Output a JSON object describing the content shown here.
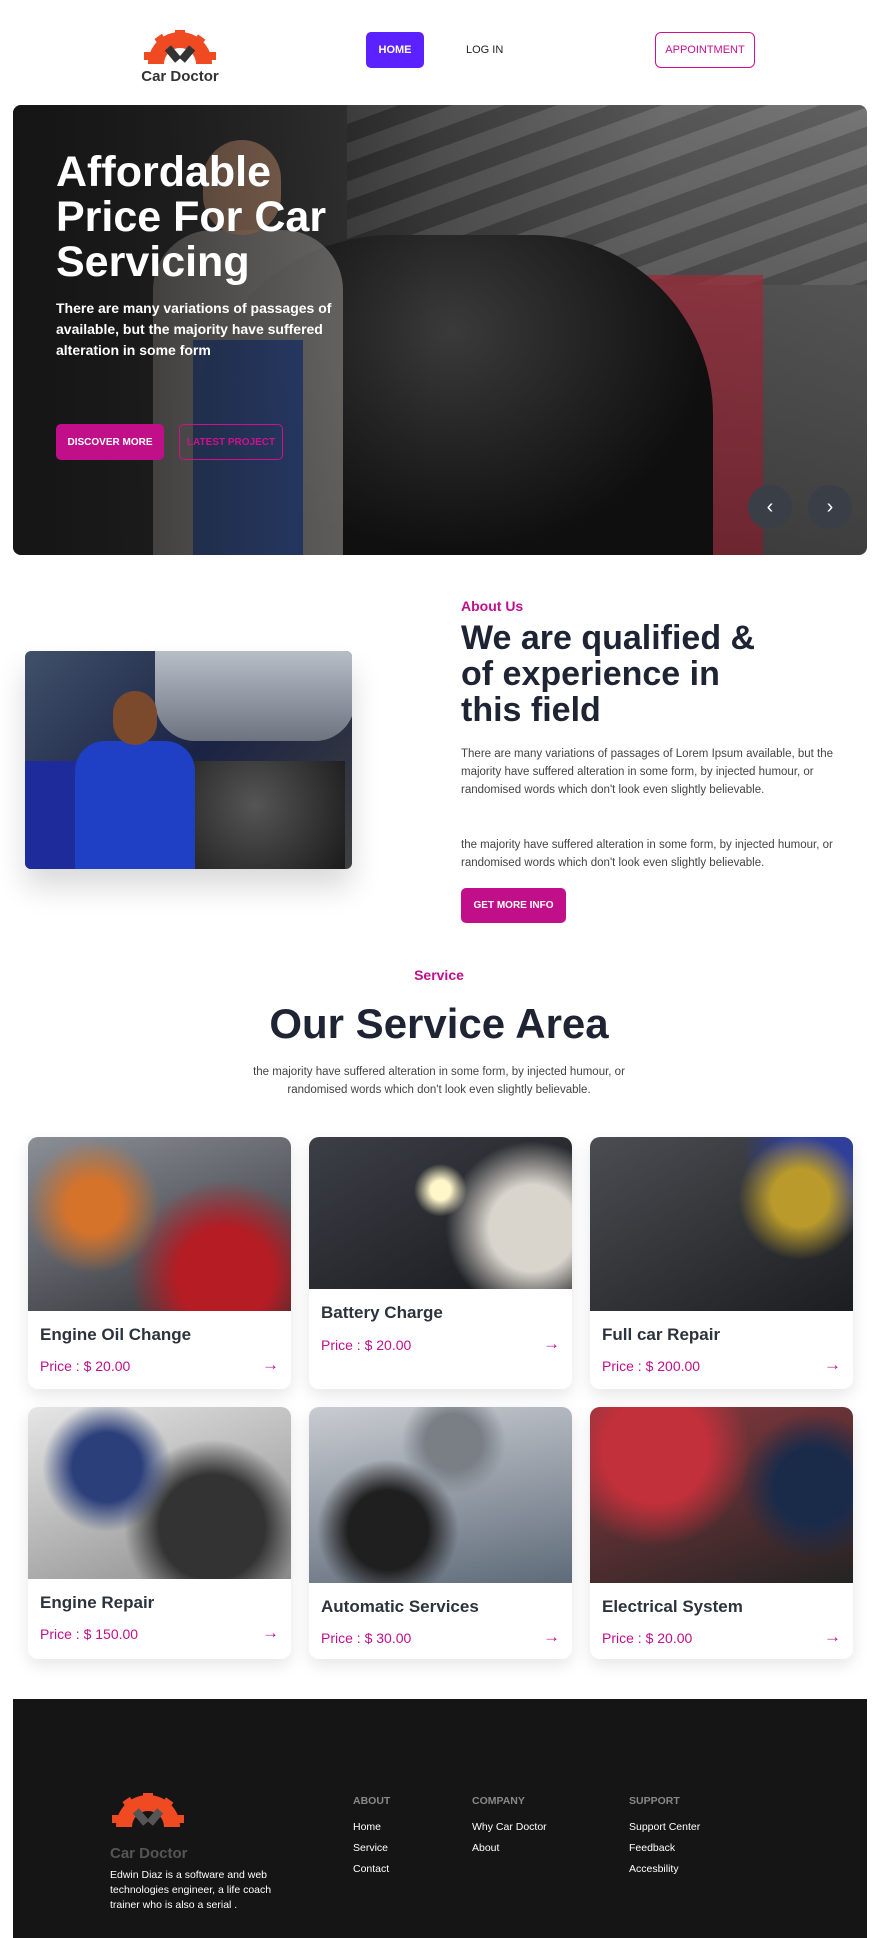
{
  "brand": {
    "name": "Car Doctor",
    "logo_icon": "gear-wrench-icon",
    "accent": "#c10f8a",
    "logo_color": "#f04a23"
  },
  "nav": {
    "home": "HOME",
    "login": "LOG IN",
    "appointment": "APPOINTMENT"
  },
  "hero": {
    "title": "Affordable Price For Car Servicing",
    "subtitle": "There are many variations of passages of available, but the majority have suffered alteration in some form",
    "discover": "DISCOVER MORE",
    "latest": "LATEST PROJECT",
    "prev": "‹",
    "next": "›"
  },
  "about": {
    "label": "About Us",
    "title": "We are qualified & of experience in this field",
    "p1": "There are many variations of passages of Lorem Ipsum available, but the majority have suffered alteration in some form, by injected humour, or randomised words which don't look even slightly believable.",
    "p2": "the majority have suffered alteration in some form, by injected humour, or randomised words which don't look even slightly believable.",
    "button": "GET MORE INFO"
  },
  "service": {
    "label": "Service",
    "title": "Our Service Area",
    "desc": "the majority have suffered alteration in some form, by injected humour, or randomised words which don't look even slightly believable.",
    "items": [
      {
        "name": "Engine Oil Change",
        "price": "Price : $ 20.00",
        "arrow": "→"
      },
      {
        "name": "Battery Charge",
        "price": "Price : $ 20.00",
        "arrow": "→"
      },
      {
        "name": "Full car Repair",
        "price": "Price : $ 200.00",
        "arrow": "→"
      },
      {
        "name": "Engine Repair",
        "price": "Price : $ 150.00",
        "arrow": "→"
      },
      {
        "name": "Automatic Services",
        "price": "Price : $ 30.00",
        "arrow": "→"
      },
      {
        "name": "Electrical System",
        "price": "Price : $ 20.00",
        "arrow": "→"
      }
    ]
  },
  "footer": {
    "brand": "Car Doctor",
    "desc": "Edwin Diaz is a software and web technologies engineer, a life coach trainer who is also a serial .",
    "about": {
      "title": "ABOUT",
      "links": [
        "Home",
        "Service",
        "Contact"
      ]
    },
    "company": {
      "title": "COMPANY",
      "links": [
        "Why Car Doctor",
        "About"
      ]
    },
    "support": {
      "title": "SUPPORT",
      "links": [
        "Support Center",
        "Feedback",
        "Accesbility"
      ]
    }
  }
}
